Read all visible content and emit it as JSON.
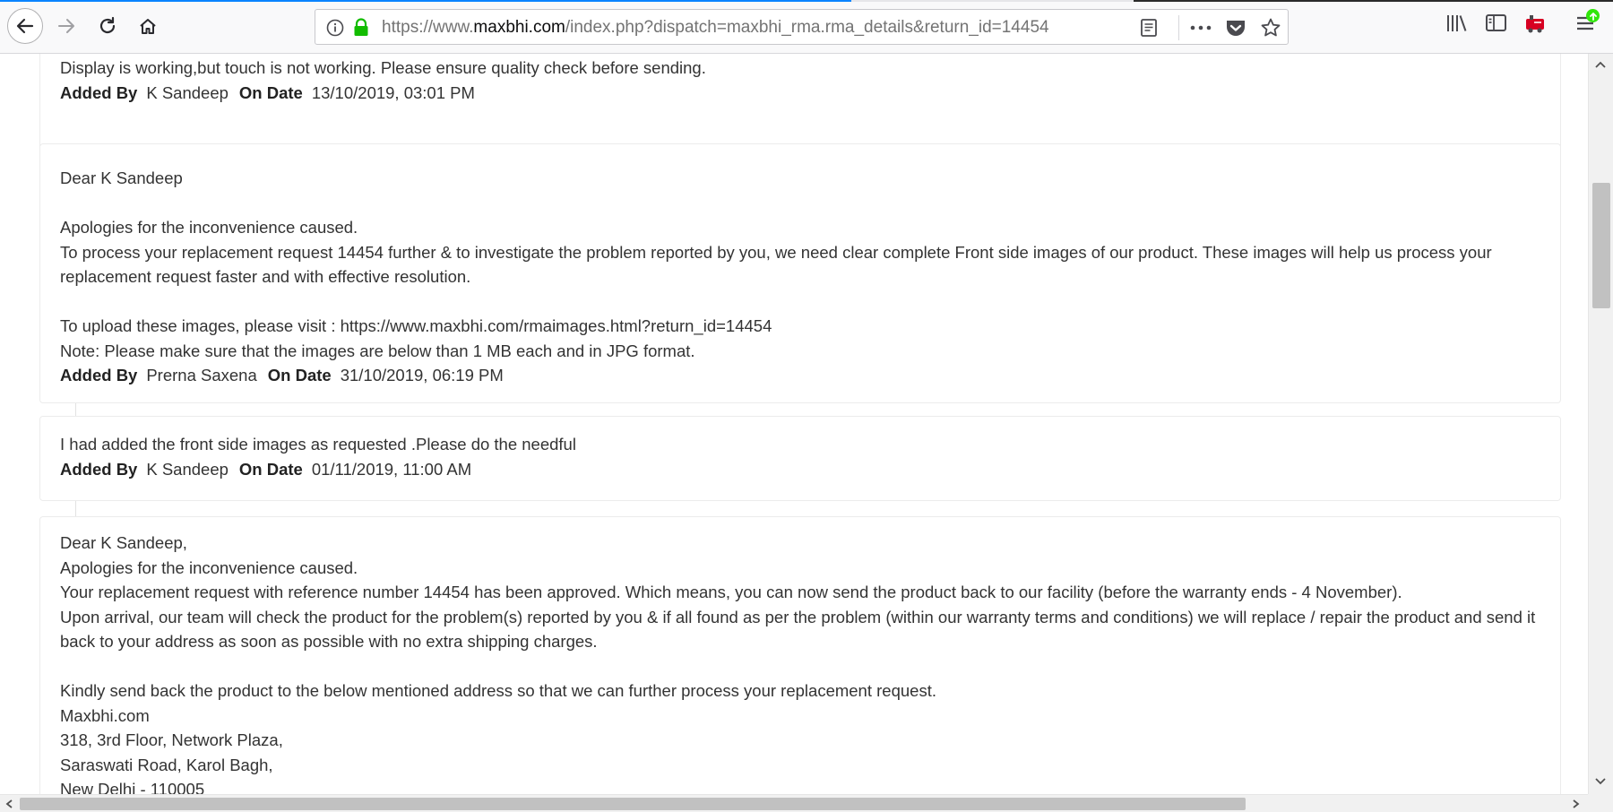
{
  "browser": {
    "url_prefix": "https://www.",
    "url_domain": "maxbhi.com",
    "url_path": "/index.php?dispatch=maxbhi_rma.rma_details&return_id=14454"
  },
  "labels": {
    "added_by": "Added By",
    "on_date": "On Date"
  },
  "comments": [
    {
      "lines": [
        "Display is working,but touch is not working. Please ensure quality check before sending."
      ],
      "added_by": "K Sandeep",
      "date": "13/10/2019, 03:01 PM"
    },
    {
      "lines": [
        "Dear K Sandeep",
        "",
        "Apologies for the inconvenience caused.",
        "To process your replacement request 14454 further & to investigate the problem reported by you, we need clear complete Front side images of our product. These images will help us process your replacement request faster and with effective resolution.",
        "",
        "To upload these images, please visit : https://www.maxbhi.com/rmaimages.html?return_id=14454",
        "Note: Please make sure that the images are below than 1 MB each and in JPG format."
      ],
      "added_by": "Prerna Saxena",
      "date": "31/10/2019, 06:19 PM"
    },
    {
      "lines": [
        "I had added the front side images as requested .Please do the needful"
      ],
      "added_by": "K Sandeep",
      "date": "01/11/2019, 11:00 AM"
    },
    {
      "lines": [
        "Dear K Sandeep,",
        "Apologies for the inconvenience caused.",
        "Your replacement request with reference number 14454 has been approved. Which means, you can now send the product back to our facility (before the warranty ends - 4 November).",
        "Upon arrival, our team will check the product for the problem(s) reported by you & if all found as per the problem (within our warranty terms and conditions) we will replace / repair the product and send it back to your address as soon as possible with no extra shipping charges.",
        "",
        "Kindly send back the product to the below mentioned address so that we can further process your replacement request.",
        "Maxbhi.com",
        "318, 3rd Floor, Network Plaza,",
        "Saraswati Road, Karol Bagh,",
        "New Delhi - 110005"
      ]
    }
  ],
  "colors": {
    "accent": "#0a84ff",
    "lock": "#12bc00",
    "text": "#333333"
  }
}
